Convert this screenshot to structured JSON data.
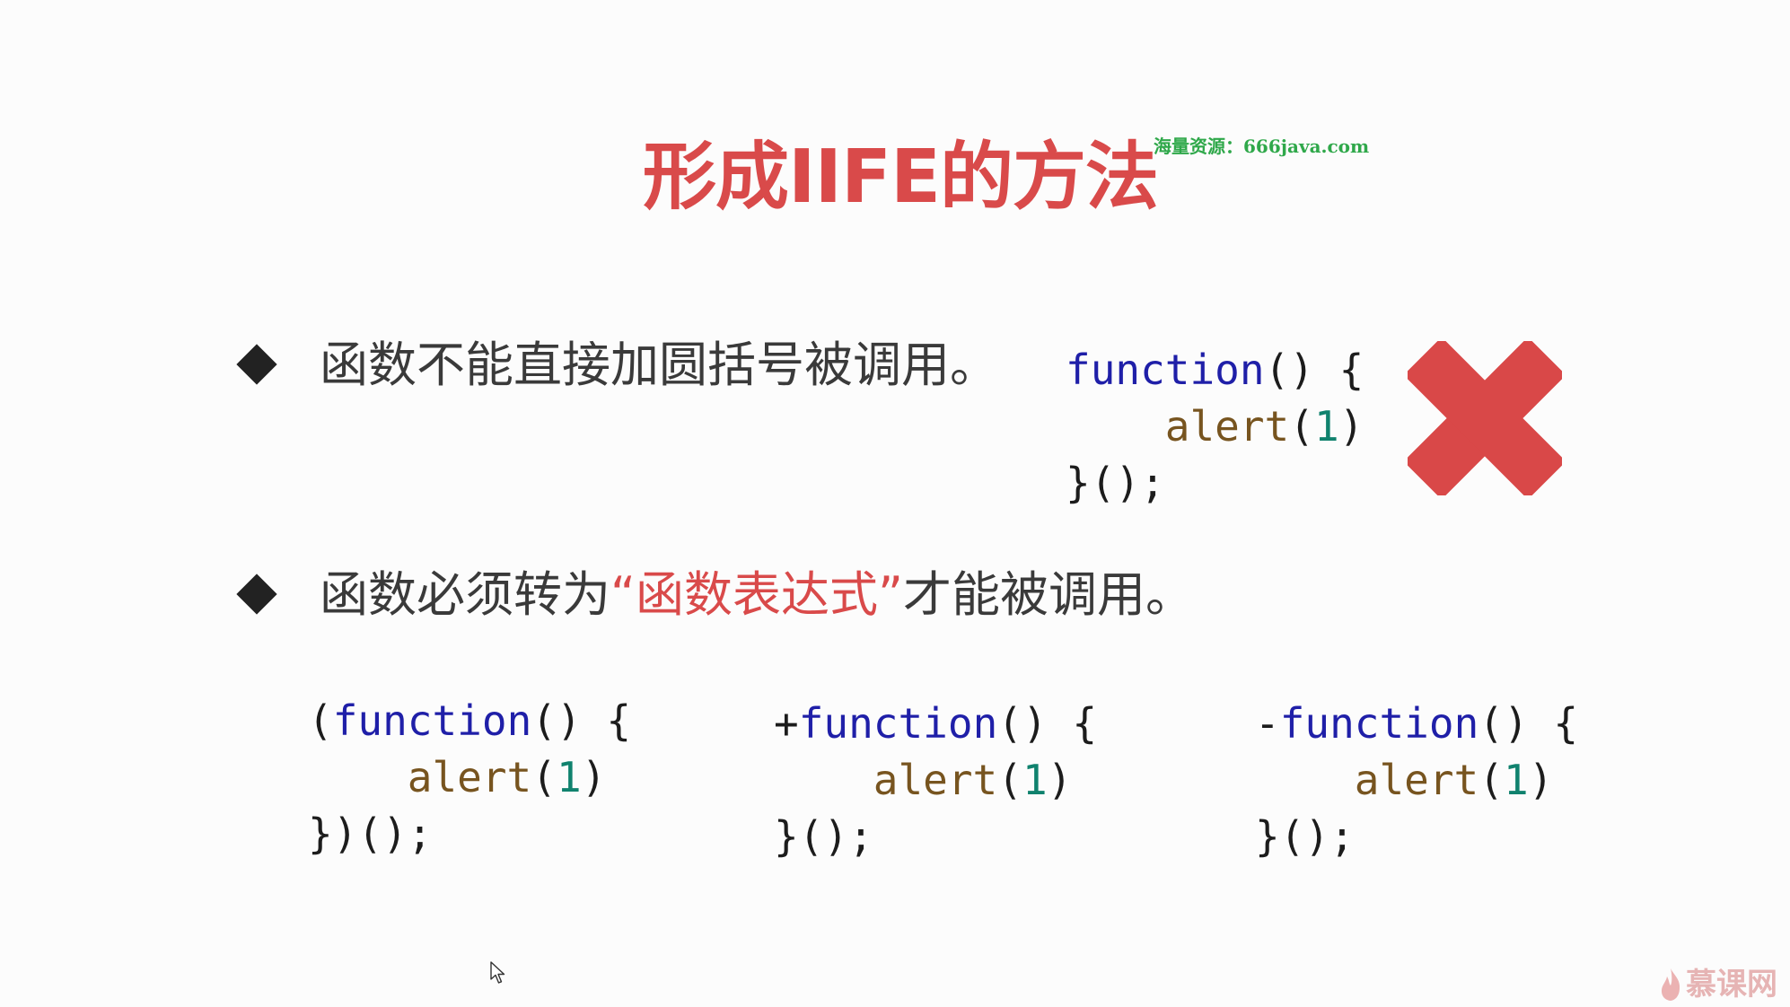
{
  "title": "形成IIFE的方法",
  "watermark": "海量资源：666java.com",
  "points": [
    {
      "text": "函数不能直接加圆括号被调用。"
    },
    {
      "text_before": "函数必须转为",
      "highlight": "“函数表达式”",
      "text_after": "才能被调用。"
    }
  ],
  "examples": {
    "wrong": {
      "prefix": "",
      "keyword": "function",
      "open": "() {",
      "call": "alert",
      "arg": "1",
      "close": "}();"
    },
    "paren": {
      "prefix": "(",
      "keyword": "function",
      "open": "() {",
      "call": "alert",
      "arg": "1",
      "close": "})();"
    },
    "plus": {
      "prefix": "+",
      "keyword": "function",
      "open": "() {",
      "call": "alert",
      "arg": "1",
      "close": "}();"
    },
    "minus": {
      "prefix": "-",
      "keyword": "function",
      "open": "() {",
      "call": "alert",
      "arg": "1",
      "close": "}();"
    }
  },
  "brand": "慕课网",
  "icons": {
    "bullet": "diamond-bullet-icon",
    "wrong": "red-cross-icon",
    "cursor": "mouse-pointer-icon",
    "brand": "flame-logo-icon"
  },
  "colors": {
    "title": "#d94a4a",
    "highlight": "#d94a4a",
    "keyword": "#1f1fa8",
    "call": "#77541f",
    "number": "#10826e",
    "cross": "#d94848",
    "watermark": "#2fa84a"
  }
}
